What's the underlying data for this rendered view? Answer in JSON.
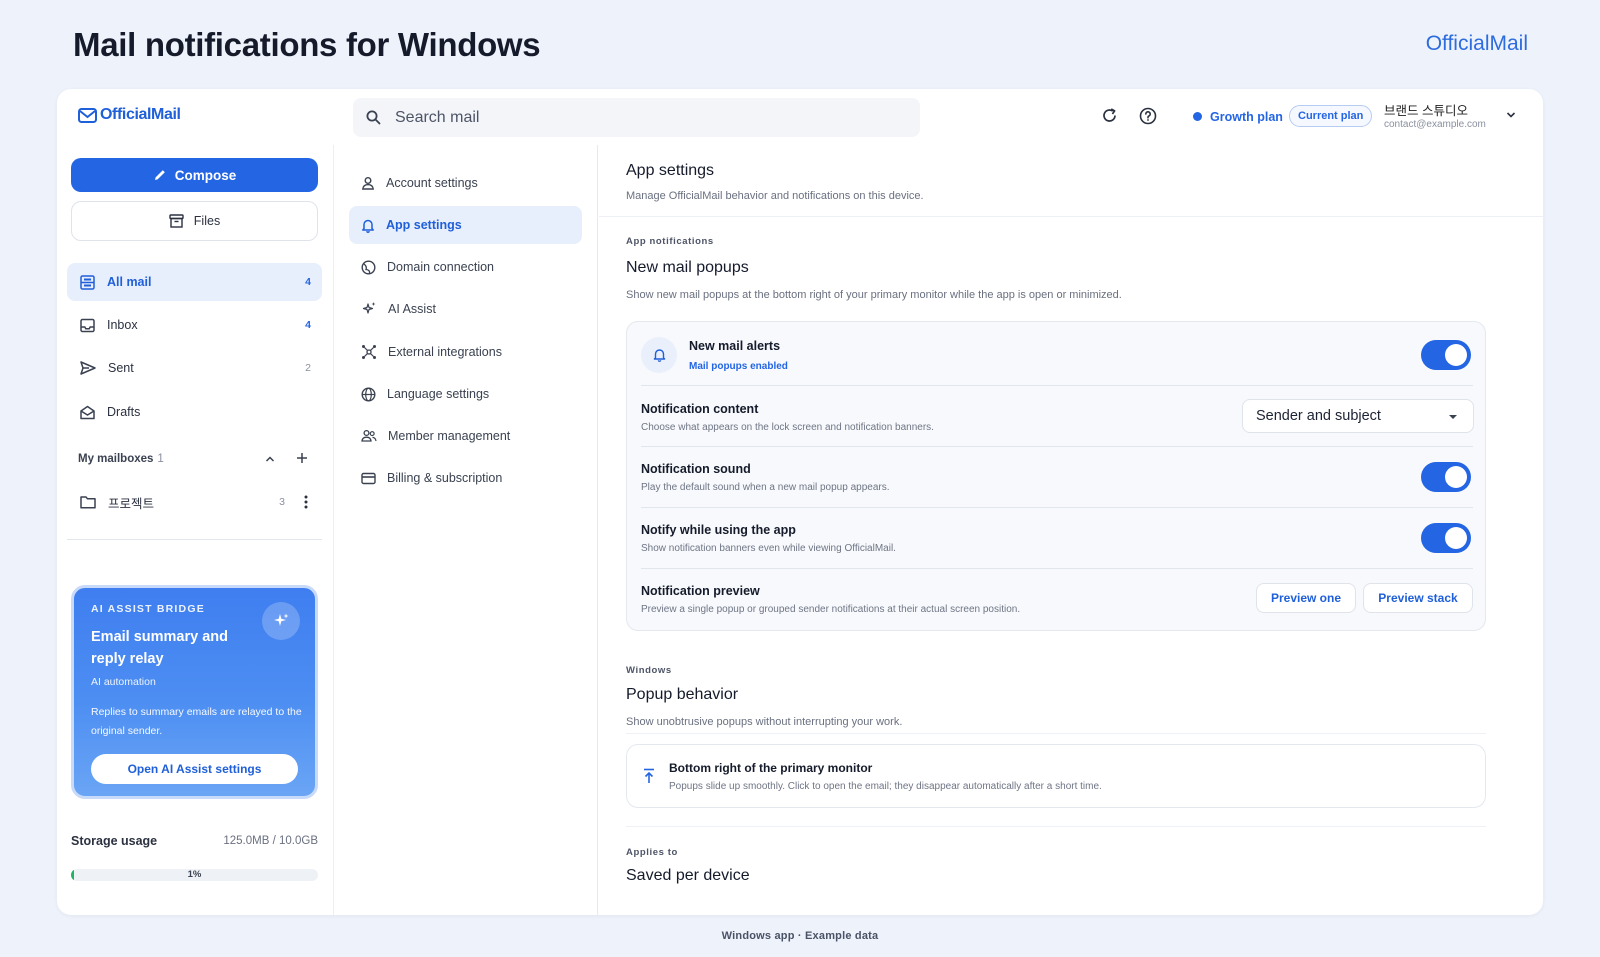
{
  "page": {
    "title": "Mail notifications for Windows",
    "brand": "OfficialMail",
    "footer": "Windows app · Example data"
  },
  "header": {
    "logo": "OfficialMail",
    "search_placeholder": "Search mail",
    "plan_name": "Growth plan",
    "plan_badge": "Current plan",
    "user_name": "브랜드 스튜디오",
    "user_email": "contact@example.com"
  },
  "sidebar": {
    "compose": "Compose",
    "files": "Files",
    "nav": [
      {
        "label": "All mail",
        "count": "4"
      },
      {
        "label": "Inbox",
        "count": "4"
      },
      {
        "label": "Sent",
        "count": "2"
      },
      {
        "label": "Drafts",
        "count": ""
      }
    ],
    "mailboxes_header": "My mailboxes",
    "mailboxes_count": "1",
    "mailboxes": [
      {
        "label": "프로젝트",
        "count": "3"
      }
    ],
    "ai_card": {
      "eyebrow": "AI ASSIST BRIDGE",
      "title": "Email summary and reply relay",
      "subtitle": "AI automation",
      "description": "Replies to summary emails are relayed to the original sender.",
      "button": "Open AI Assist settings"
    },
    "storage": {
      "label": "Storage usage",
      "value": "125.0MB / 10.0GB",
      "percent_label": "1%",
      "fraction": 0.0122
    }
  },
  "settings_nav": [
    {
      "label": "Account settings",
      "icon": "user-icon"
    },
    {
      "label": "App settings",
      "icon": "bell-icon"
    },
    {
      "label": "Domain connection",
      "icon": "globe-icon"
    },
    {
      "label": "AI Assist",
      "icon": "sparkle-icon"
    },
    {
      "label": "External integrations",
      "icon": "network-icon"
    },
    {
      "label": "Language settings",
      "icon": "language-icon"
    },
    {
      "label": "Member management",
      "icon": "members-icon"
    },
    {
      "label": "Billing & subscription",
      "icon": "card-icon"
    }
  ],
  "content": {
    "title": "App settings",
    "subtitle": "Manage OfficialMail behavior and notifications on this device.",
    "notifications": {
      "eyebrow": "App notifications",
      "title": "New mail popups",
      "subtitle": "Show new mail popups at the bottom right of your primary monitor while the app is open or minimized.",
      "alerts_title": "New mail alerts",
      "alerts_status": "Mail popups enabled",
      "alerts_enabled": true,
      "content_title": "Notification content",
      "content_desc": "Choose what appears on the lock screen and notification banners.",
      "content_value": "Sender and subject",
      "sound_title": "Notification sound",
      "sound_desc": "Play the default sound when a new mail popup appears.",
      "sound_enabled": true,
      "inapp_title": "Notify while using the app",
      "inapp_desc": "Show notification banners even while viewing OfficialMail.",
      "inapp_enabled": true,
      "preview_title": "Notification preview",
      "preview_desc": "Preview a single popup or grouped sender notifications at their actual screen position.",
      "preview_one": "Preview one",
      "preview_stack": "Preview stack"
    },
    "windows": {
      "eyebrow": "Windows",
      "title": "Popup behavior",
      "subtitle": "Show unobtrusive popups without interrupting your work.",
      "option_title": "Bottom right of the primary monitor",
      "option_desc": "Popups slide up smoothly. Click to open the email; they disappear automatically after a short time."
    },
    "applies": {
      "eyebrow": "Applies to",
      "title": "Saved per device"
    }
  },
  "colors": {
    "accent": "#2465e3",
    "background": "#eef2fa",
    "storage_fill": "#22b366"
  }
}
